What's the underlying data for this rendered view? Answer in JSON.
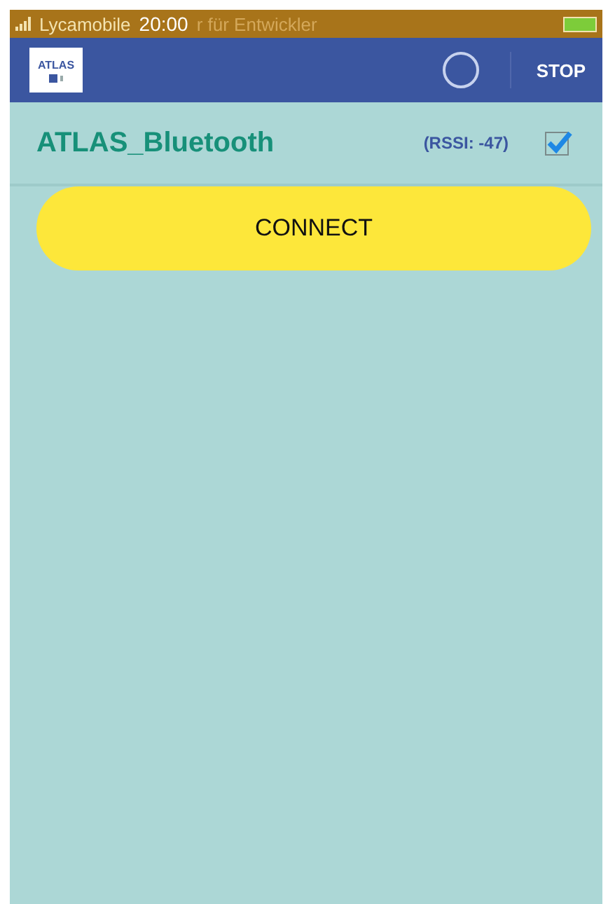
{
  "status_bar": {
    "carrier": "Lycamobile",
    "notice": "r für Entwickler",
    "time": "20:00"
  },
  "app_bar": {
    "logo": "ATLAS",
    "scanning": true,
    "action": "STOP"
  },
  "devices": [
    {
      "name": "ATLAS_Bluetooth",
      "rssi": "(RSSI: -47)",
      "checked": true
    }
  ],
  "connect_button": "CONNECT"
}
